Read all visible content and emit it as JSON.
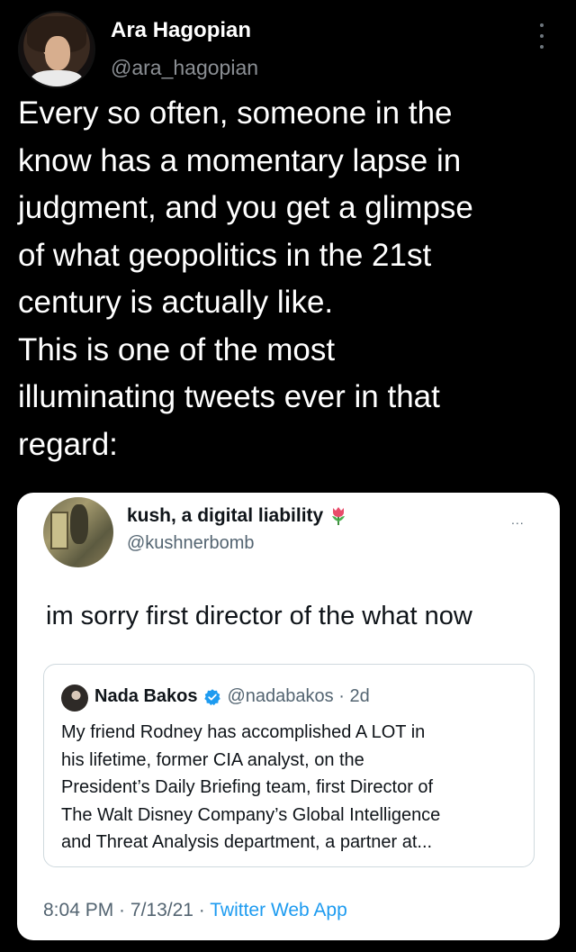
{
  "outer_tweet": {
    "author_name": "Ara Hagopian",
    "author_handle": "@ara_hagopian",
    "text_lines": [
      "Every so often, someone in the",
      "know has a momentary lapse in",
      "judgment, and you get a glimpse",
      "of what geopolitics in the 21st",
      "century is actually like.",
      "This is one of the most",
      "illuminating tweets ever in that",
      "regard:"
    ]
  },
  "embedded_tweet": {
    "author_name": "kush, a digital liability",
    "author_handle": "@kushnerbomb",
    "more_label": "...",
    "text": "im sorry first director of the what now",
    "quoted": {
      "author_name": "Nada Bakos",
      "author_handle": "@nadabakos",
      "separator": " · ",
      "time": "2d",
      "text_lines": [
        "My friend Rodney has accomplished A LOT in",
        "his lifetime, former CIA analyst, on the",
        "President’s Daily Briefing team, first Director of",
        "The Walt Disney Company’s Global Intelligence",
        "and Threat Analysis department, a partner at..."
      ]
    },
    "meta": {
      "time": "8:04 PM",
      "separator": " · ",
      "date": "7/13/21",
      "separator2": " · ",
      "app": "Twitter Web App"
    }
  },
  "colors": {
    "background": "#000000",
    "card_background": "#ffffff",
    "secondary_text": "#536471",
    "link": "#1d9bf0",
    "verified": "#1d9bf0"
  },
  "icons": [
    "more-vertical-icon",
    "tulip-emoji-icon",
    "verified-badge-icon",
    "more-horizontal-icon"
  ]
}
